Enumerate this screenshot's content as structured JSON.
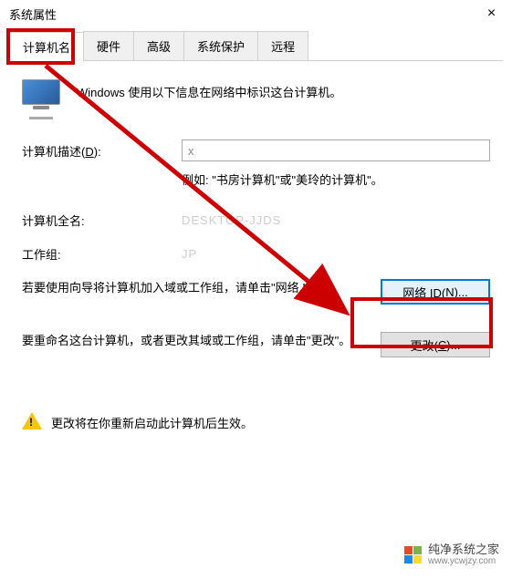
{
  "window": {
    "title": "系统属性",
    "close_label": "×"
  },
  "tabs": {
    "computer_name": "计算机名",
    "hardware": "硬件",
    "advanced": "高级",
    "system_protection": "系统保护",
    "remote": "远程"
  },
  "intro": {
    "text": "Windows 使用以下信息在网络中标识这台计算机。"
  },
  "fields": {
    "description_label": "计算机描述(D):",
    "description_value": "x",
    "description_hint": "例如: \"书房计算机\"或\"美玲的计算机\"。",
    "fullname_label": "计算机全名:",
    "fullname_value": "DESKTOP-JJDS",
    "workgroup_label": "工作组:",
    "workgroup_value": "JP"
  },
  "actions": {
    "network_id_text": "若要使用向导将计算机加入域或工作组，请单击\"网络 ID\"。",
    "network_id_button": "网络 ID(N)...",
    "change_text": "要重命名这台计算机，或者更改其域或工作组，请单击\"更改\"。",
    "change_button": "更改(C)..."
  },
  "footer": {
    "warning": "更改将在你重新启动此计算机后生效。"
  },
  "watermark": {
    "name": "纯净系统之家",
    "url": "www.ycwjzy.com"
  }
}
